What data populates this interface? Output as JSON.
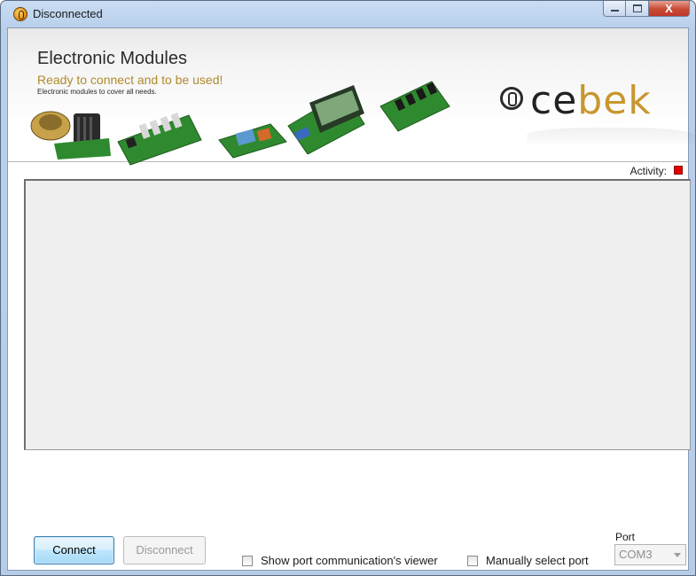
{
  "window": {
    "title": "Disconnected",
    "close_glyph": "X"
  },
  "banner": {
    "title": "Electronic Modules",
    "subtitle": "Ready to connect and to be used!",
    "description": "Electronic modules to cover all needs.",
    "logo": {
      "part1": "ce",
      "part2": "bek",
      "icon": "cebek-logo-icon"
    }
  },
  "activity": {
    "label": "Activity:",
    "color": "#e00000"
  },
  "buttons": {
    "connect": "Connect",
    "disconnect": "Disconnect"
  },
  "options": {
    "show_viewer": {
      "label": "Show port communication's viewer",
      "checked": false
    },
    "manual_port": {
      "label": "Manually select port",
      "checked": false
    }
  },
  "port": {
    "label": "Port",
    "value": "COM3"
  },
  "colors": {
    "accent_gold": "#c9962f",
    "pcb_green": "#2f8a2f"
  }
}
